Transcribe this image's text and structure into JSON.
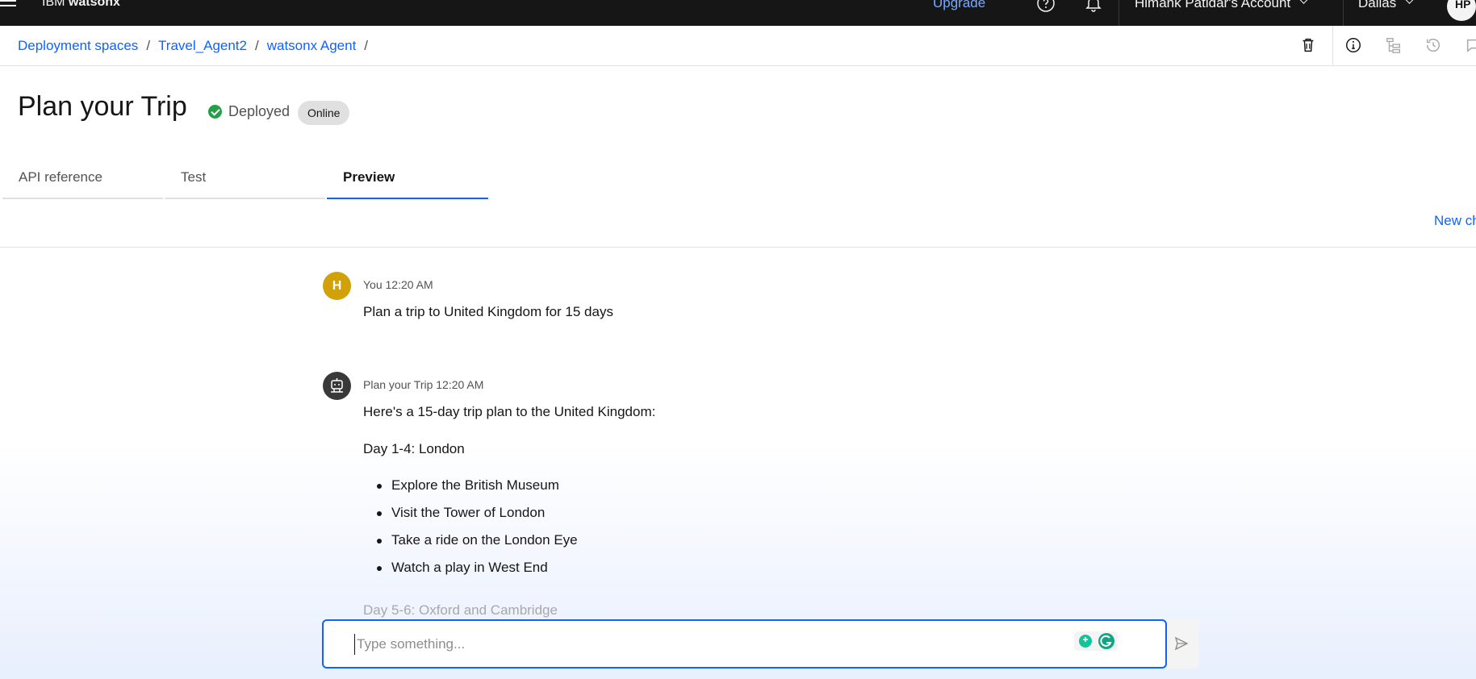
{
  "topbar": {
    "brand_prefix": "IBM",
    "brand_name": "watsonx",
    "upgrade_label": "Upgrade",
    "account_label": "Himank Patidar's Account",
    "region_label": "Dallas",
    "avatar_initials": "HP"
  },
  "breadcrumb": {
    "items": [
      "Deployment spaces",
      "Travel_Agent2",
      "watsonx Agent"
    ],
    "separator": "/"
  },
  "header": {
    "title": "Plan your Trip",
    "status_label": "Deployed",
    "status_color": "#24a148",
    "tag_label": "Online"
  },
  "tabs": [
    {
      "label": "API reference",
      "active": false
    },
    {
      "label": "Test",
      "active": false
    },
    {
      "label": "Preview",
      "active": true
    }
  ],
  "new_chat_label": "New chat",
  "messages": [
    {
      "avatar": "H",
      "author": "You",
      "time": "12:20 AM",
      "text": "Plan a trip to United Kingdom for 15 days"
    },
    {
      "avatar_icon": "robot-icon",
      "author": "Plan your Trip",
      "time": "12:20 AM",
      "intro": "Here's a 15-day trip plan to the United Kingdom:",
      "section1_title": "Day 1-4: London",
      "section1_items": [
        "Explore the British Museum",
        "Visit the Tower of London",
        "Take a ride on the London Eye",
        "Watch a play in West End"
      ],
      "section2_title": "Day 5-6: Oxford and Cambridge"
    }
  ],
  "composer": {
    "placeholder": "Type something..."
  },
  "colors": {
    "accent": "#0f62fe",
    "topbar_bg": "#161616",
    "user_avatar": "#d2a106",
    "bot_avatar": "#393939"
  }
}
